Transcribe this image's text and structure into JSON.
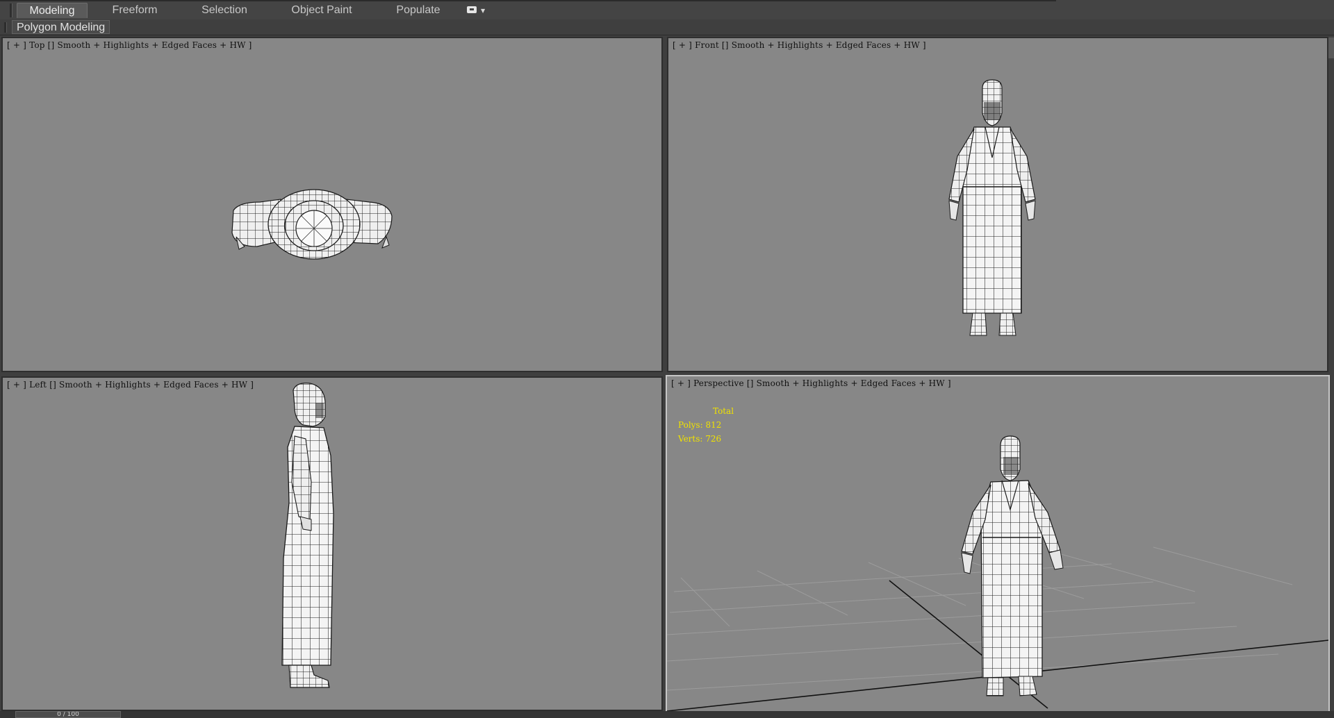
{
  "ribbon": {
    "tabs": [
      {
        "label": "Modeling",
        "active": true
      },
      {
        "label": "Freeform",
        "active": false
      },
      {
        "label": "Selection",
        "active": false
      },
      {
        "label": "Object Paint",
        "active": false
      },
      {
        "label": "Populate",
        "active": false
      }
    ],
    "options_icon": "view-options-icon",
    "panel_label": "Polygon Modeling"
  },
  "viewports": {
    "top": {
      "bracket_open": "[ + ] ",
      "view": "Top",
      "mode": "Smooth + Highlights + Edged Faces + HW ]"
    },
    "front": {
      "bracket_open": "[ + ] ",
      "view": "Front",
      "mode": "Smooth + Highlights + Edged Faces + HW ]"
    },
    "left": {
      "bracket_open": "[ + ] ",
      "view": "Left",
      "mode": "Smooth + Highlights + Edged Faces + HW ]"
    },
    "perspective": {
      "bracket_open": "[ + ] ",
      "view": "Perspective",
      "mode": "Smooth + Highlights + Edged Faces + HW ]",
      "stats": {
        "total_label": "Total",
        "polys": "Polys: 812",
        "verts": "Verts: 726"
      }
    }
  },
  "time_slider": "0 / 100",
  "colors": {
    "viewport_bg": "#878787",
    "ui_bg": "#3f3f3f",
    "stats_text": "#f0e200",
    "mesh_fill": "#f4f4f4",
    "mesh_wire": "#1a1a1a"
  }
}
